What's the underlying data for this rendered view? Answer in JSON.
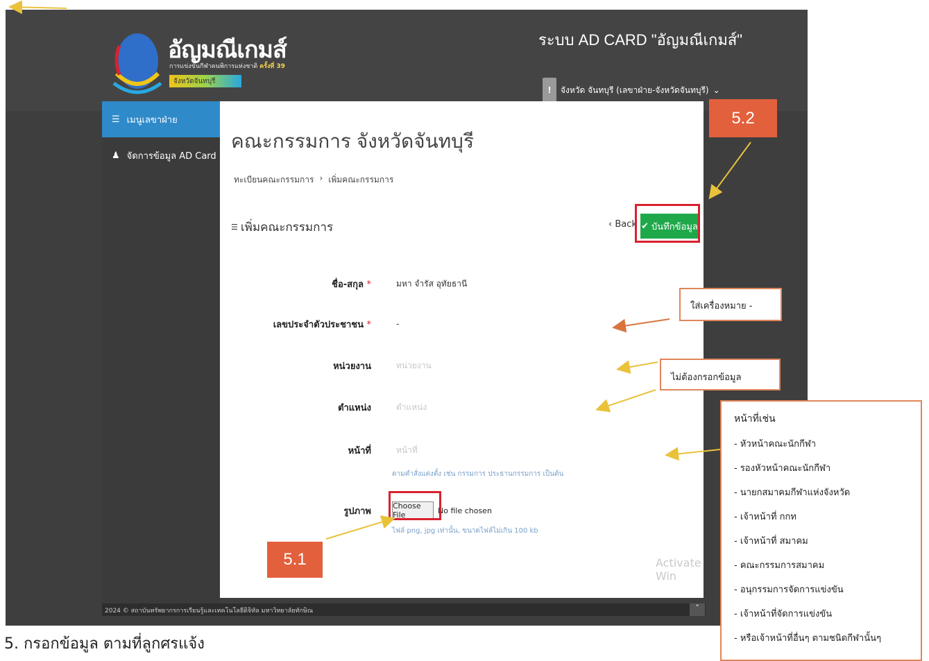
{
  "app": {
    "logo_title": "อัญมณีเกมส์",
    "logo_subtitle": "การแข่งขันกีฬาคนพิการแห่งชาติ",
    "logo_round": "ครั้งที่ 39",
    "logo_badge": "จังหวัดจันทบุรี",
    "system_title": "ระบบ AD CARD \"อัญมณีเกมส์\"",
    "user_label": "จังหวัด จันทบุรี (เลขาฝ่าย-จังหวัดจันทบุรี)"
  },
  "sidebar": {
    "items": [
      {
        "label": "เมนูเลขาฝ่าย",
        "icon": "list-icon"
      },
      {
        "label": "จัดการข้อมูล AD Card",
        "icon": "user-icon"
      }
    ]
  },
  "page": {
    "title": "คณะกรรมการ จังหวัดจันทบุรี",
    "breadcrumb": [
      "ทะเบียนคณะกรรมการ",
      "เพิ่มคณะกรรมการ"
    ],
    "section_title": "เพิ่มคณะกรรมการ",
    "back_label": "Back",
    "save_label": "บันทึกข้อมูล"
  },
  "form": {
    "name_label": "ชื่อ-สกุล",
    "name_value": "มหา จำรัส อุทัยธานี",
    "id_label": "เลขประจำตัวประชาชน",
    "id_value": "-",
    "unit_label": "หน่วยงาน",
    "unit_placeholder": "หน่วยงาน",
    "position_label": "ตำแหน่ง",
    "position_placeholder": "ตำแหน่ง",
    "duty_label": "หน้าที่",
    "duty_placeholder": "หน้าที่",
    "duty_hint": "ตามคำสั่งแต่งตั้ง เช่น กรรมการ ประธานกรรมการ เป็นต้น",
    "photo_label": "รูปภาพ",
    "choose_file": "Choose File",
    "no_file": "No file chosen",
    "file_note": "ไฟล์ png, jpg เท่านั้น, ขนาดไฟล์ไม่เกิน 100 kb"
  },
  "footer": {
    "text": "2024 © สถาบันทรัพยากรการเรียนรู้และเทคโนโลยีดิจิทัล มหาวิทยาลัยทักษิณ",
    "activate": "Activate Win"
  },
  "annotations": {
    "step_5_2": "5.2",
    "step_5_1": "5.1",
    "note_dash": "ใส่เครื่องหมาย -",
    "note_skip": "ไม่ต้องกรอกข้อมูล",
    "duty_examples_title": "หน้าที่เช่น",
    "duty_examples": [
      "- หัวหน้าคณะนักกีฬา",
      "- รองหัวหน้าคณะนักกีฬา",
      "- นายกสมาคมกีฬาแห่งจังหวัด",
      "- เจ้าหน้าที่ กกท",
      "- เจ้าหน้าที่ สมาคม",
      "- คณะกรรมการสมาคม",
      "- อนุกรรมการจัดการแข่งขัน",
      "- เจ้าหน้าที่จัดการแข่งขัน",
      "- หรือเจ้าหน้าที่อื่นๆ ตามชนิดกีฬานั้นๆ"
    ],
    "caption": "5. กรอกข้อมูล ตามที่ลูกศรแจ้ง"
  },
  "colors": {
    "accent": "#2f8ac9",
    "save": "#1fa84a",
    "highlight": "#d8212f",
    "callout": "#e2603c"
  }
}
